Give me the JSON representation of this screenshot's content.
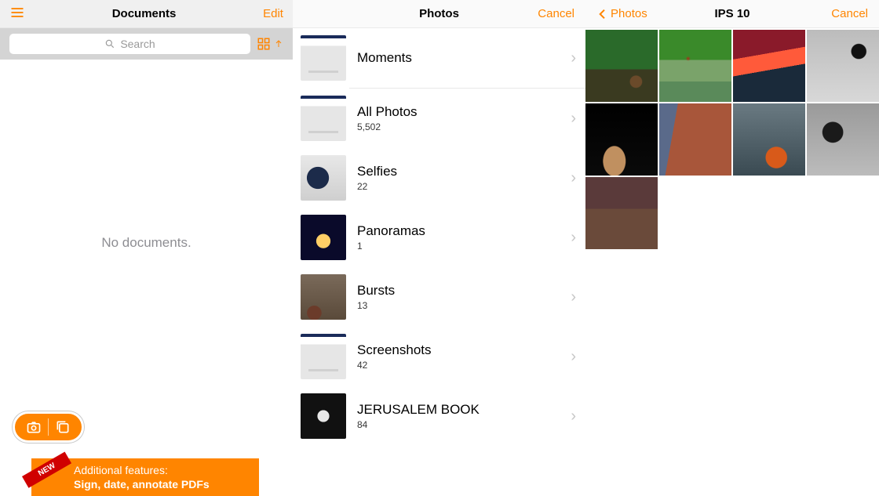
{
  "documents": {
    "title": "Documents",
    "edit": "Edit",
    "search_placeholder": "Search",
    "empty": "No documents.",
    "banner_line1": "Additional features:",
    "banner_line2": "Sign, date, annotate PDFs",
    "banner_ribbon": "NEW"
  },
  "photos": {
    "title": "Photos",
    "cancel": "Cancel",
    "albums": [
      {
        "name": "Moments"
      },
      {
        "name": "All Photos",
        "count": "5,502"
      },
      {
        "name": "Selfies",
        "count": "22"
      },
      {
        "name": "Panoramas",
        "count": "1"
      },
      {
        "name": "Bursts",
        "count": "13"
      },
      {
        "name": "Screenshots",
        "count": "42"
      },
      {
        "name": "JERUSALEM BOOK",
        "count": "84"
      }
    ]
  },
  "album": {
    "back": "Photos",
    "title": "IPS 10",
    "cancel": "Cancel"
  }
}
